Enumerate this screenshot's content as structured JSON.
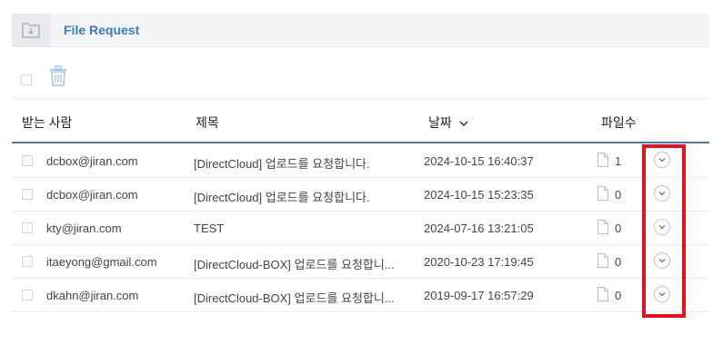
{
  "header": {
    "title": "File Request",
    "icon": "folder-download-icon"
  },
  "toolbar": {
    "select_all": false,
    "delete_icon": "trash-icon"
  },
  "table": {
    "columns": {
      "recipient": "받는 사람",
      "subject": "제목",
      "date": "날짜",
      "date_sort_icon": "chevron-down-icon",
      "file_count": "파일수"
    },
    "rows": [
      {
        "recipient": "dcbox@jiran.com",
        "subject": "[DirectCloud] 업로드를 요청합니다.",
        "date": "2024-10-15 16:40:37",
        "files": "1"
      },
      {
        "recipient": "dcbox@jiran.com",
        "subject": "[DirectCloud] 업로드를 요청합니다.",
        "date": "2024-10-15 15:23:35",
        "files": "0"
      },
      {
        "recipient": "kty@jiran.com",
        "subject": "TEST",
        "date": "2024-07-16 13:21:05",
        "files": "0"
      },
      {
        "recipient": "itaeyong@gmail.com",
        "subject": "[DirectCloud-BOX] 업로드를 요청합니...",
        "date": "2020-10-23 17:19:45",
        "files": "0"
      },
      {
        "recipient": "dkahn@jiran.com",
        "subject": "[DirectCloud-BOX] 업로드를 요청합니...",
        "date": "2019-09-17 16:57:29",
        "files": "0"
      }
    ]
  },
  "colors": {
    "accent": "#3b7ac0",
    "highlight": "#e0141e",
    "header_rule": "#5277a8"
  }
}
